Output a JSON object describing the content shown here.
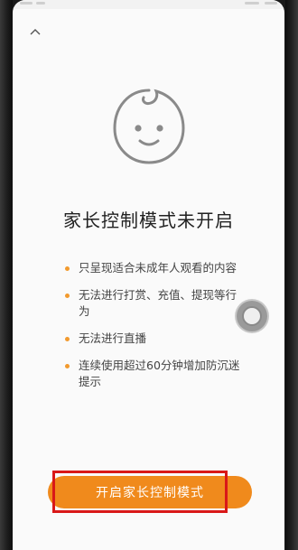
{
  "header": {
    "back_icon": "chevron-up-icon"
  },
  "hero": {
    "icon": "baby-face-icon"
  },
  "title": "家长控制模式未开启",
  "restrictions": [
    {
      "text": "只呈现适合未成年人观看的内容"
    },
    {
      "text": "无法进行打赏、充值、提现等行为"
    },
    {
      "text": "无法进行直播"
    },
    {
      "text": "连续使用超过60分钟增加防沉迷提示"
    }
  ],
  "floating_button": {
    "icon": "assistive-touch-icon"
  },
  "action": {
    "enable_label": "开启家长控制模式"
  },
  "colors": {
    "accent": "#f08a1c",
    "bullet": "#f29a2e",
    "highlight": "#d91818"
  }
}
